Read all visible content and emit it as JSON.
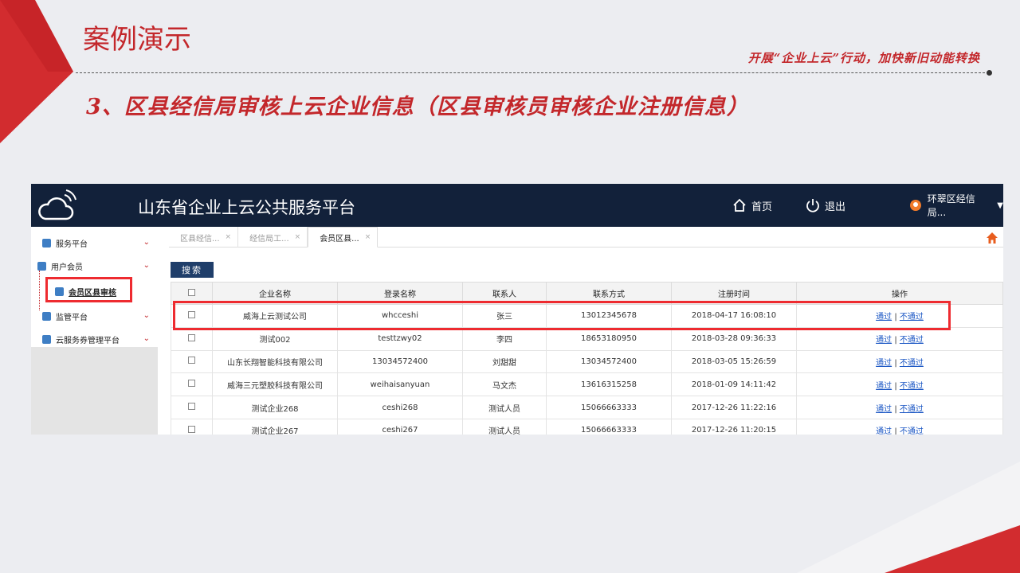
{
  "slide": {
    "title": "案例演示",
    "slogan": "开展“企业上云”行动，加快新旧动能转换",
    "subtitle": "3、区县经信局审核上云企业信息（区县审核员审核企业注册信息）",
    "accent_color": "#c3272b"
  },
  "app": {
    "title": "山东省企业上云公共服务平台",
    "nav": {
      "home": "首页",
      "logout": "退出",
      "user": "环翠区经信局..."
    },
    "sidebar": {
      "items": [
        {
          "label": "服务平台"
        },
        {
          "label": "用户会员"
        },
        {
          "label": "会员区县审核"
        },
        {
          "label": "监管平台"
        },
        {
          "label": "云服务券管理平台"
        }
      ]
    },
    "tabs": [
      {
        "label": "区县经信..."
      },
      {
        "label": "经信局工..."
      },
      {
        "label": "会员区县..."
      }
    ],
    "search_label": "搜索",
    "table": {
      "headers": [
        "企业名称",
        "登录名称",
        "联系人",
        "联系方式",
        "注册时间",
        "操作"
      ],
      "rows": [
        {
          "name": "威海上云测试公司",
          "login": "whcceshi",
          "contact": "张三",
          "phone": "13012345678",
          "time": "2018-04-17 16:08:10"
        },
        {
          "name": "测试002",
          "login": "testtzwy02",
          "contact": "李四",
          "phone": "18653180950",
          "time": "2018-03-28 09:36:33"
        },
        {
          "name": "山东长翔智能科技有限公司",
          "login": "13034572400",
          "contact": "刘甜甜",
          "phone": "13034572400",
          "time": "2018-03-05 15:26:59"
        },
        {
          "name": "威海三元塑胶科技有限公司",
          "login": "weihaisanyuan",
          "contact": "马文杰",
          "phone": "13616315258",
          "time": "2018-01-09 14:11:42"
        },
        {
          "name": "测试企业268",
          "login": "ceshi268",
          "contact": "测试人员",
          "phone": "15066663333",
          "time": "2017-12-26 11:22:16"
        },
        {
          "name": "测试企业267",
          "login": "ceshi267",
          "contact": "测试人员",
          "phone": "15066663333",
          "time": "2017-12-26 11:20:15"
        }
      ],
      "op_pass": "通过",
      "op_sep": "|",
      "op_reject": "不通过"
    }
  }
}
